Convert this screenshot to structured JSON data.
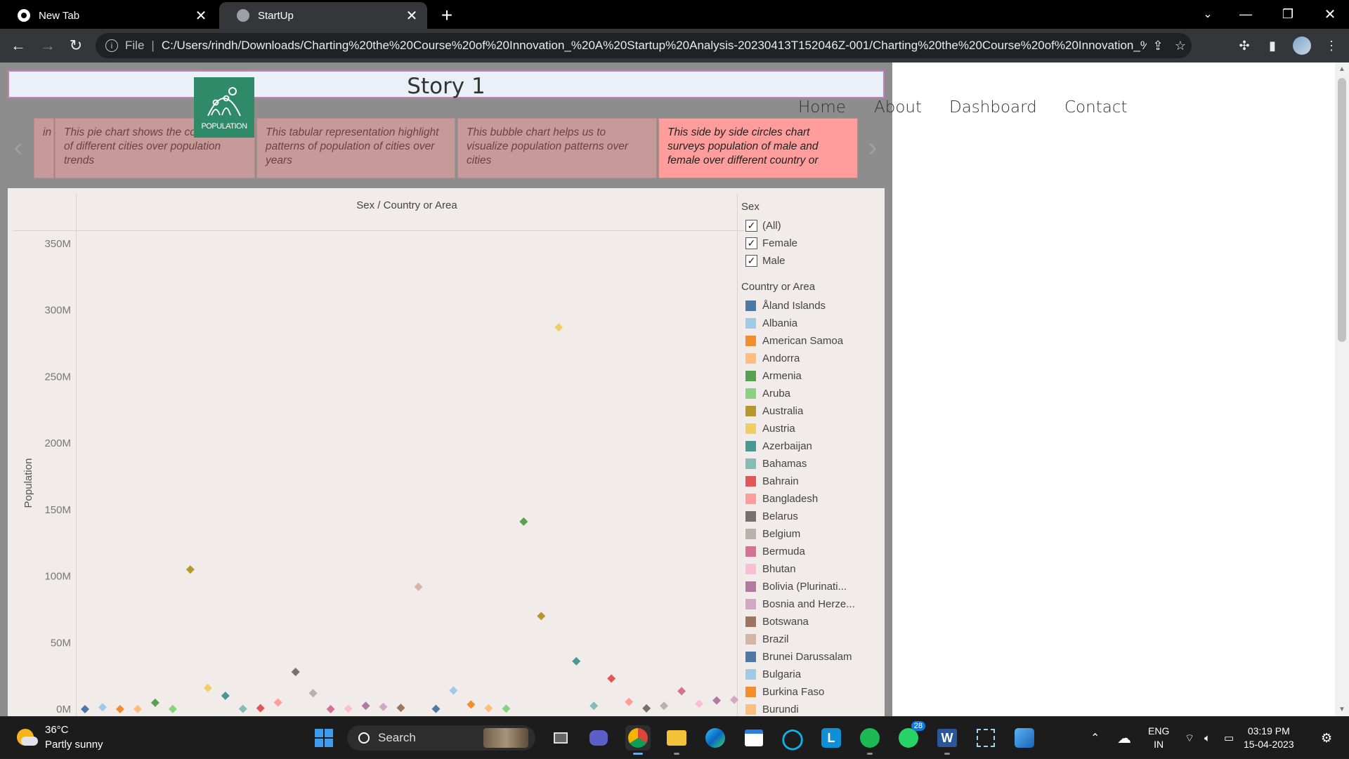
{
  "browser": {
    "tabs": [
      {
        "title": "New Tab",
        "active": false
      },
      {
        "title": "StartUp",
        "active": true
      }
    ],
    "scheme_label": "File",
    "url": "C:/Users/rindh/Downloads/Charting%20the%20Course%20of%20Innovation_%20A%20Startup%20Analysis-20230413T152046Z-001/Charting%20the%20Course%20of%20Innovation_%..."
  },
  "page": {
    "story_title": "Story 1",
    "logo_text": "POPULATION",
    "nav": [
      "Home",
      "About",
      "Dashboard",
      "Contact"
    ],
    "captions": [
      {
        "text": "in",
        "active": false
      },
      {
        "text": "This pie chart shows the contribution of different cities over population trends",
        "active": false
      },
      {
        "text": "This tabular representation highlight  patterns of population of cities over years",
        "active": false
      },
      {
        "text": "This bubble chart helps us to visualize population patterns over cities",
        "active": false
      },
      {
        "text": "This side by side circles chart surveys population of male and female over different country or",
        "active": true
      }
    ]
  },
  "chart_data": {
    "type": "scatter",
    "title": "Sex / Country or Area",
    "xlabel": "",
    "ylabel": "Population",
    "ylim": [
      0,
      360000000
    ],
    "yticks": [
      "0M",
      "50M",
      "100M",
      "150M",
      "200M",
      "250M",
      "300M",
      "350M"
    ],
    "ytick_values": [
      0,
      50000000,
      100000000,
      150000000,
      200000000,
      250000000,
      300000000,
      350000000
    ],
    "marker": "diamond",
    "gridlines": false,
    "legend_position": "right",
    "series": [
      {
        "name": "Åland Islands",
        "color": "#4e79a7",
        "values": [
          15000
        ]
      },
      {
        "name": "Albania",
        "color": "#a0cbe8",
        "values": [
          1400000
        ]
      },
      {
        "name": "American Samoa",
        "color": "#f28e2b",
        "values": [
          28000
        ]
      },
      {
        "name": "Andorra",
        "color": "#ffbe7d",
        "values": [
          38000
        ]
      },
      {
        "name": "Armenia",
        "color": "#59a14f",
        "values": [
          4800000
        ]
      },
      {
        "name": "Aruba",
        "color": "#8cd17d",
        "values": [
          52000
        ]
      },
      {
        "name": "Australia",
        "color": "#b6992d",
        "values": [
          105000000
        ]
      },
      {
        "name": "Austria",
        "color": "#f1ce63",
        "values": [
          16000000
        ]
      },
      {
        "name": "Azerbaijan",
        "color": "#499894",
        "values": [
          10000000
        ]
      },
      {
        "name": "Bahamas",
        "color": "#86bcb6",
        "values": [
          180000
        ]
      },
      {
        "name": "Bahrain",
        "color": "#e15759",
        "values": [
          700000
        ]
      },
      {
        "name": "Bangladesh",
        "color": "#ff9d9a",
        "values": [
          5000000
        ]
      },
      {
        "name": "Belarus",
        "color": "#79706e",
        "values": [
          28000000
        ]
      },
      {
        "name": "Belgium",
        "color": "#bab0ac",
        "values": [
          12000000
        ]
      },
      {
        "name": "Bermuda",
        "color": "#d37295",
        "values": [
          32000
        ]
      },
      {
        "name": "Bhutan",
        "color": "#fabfd2",
        "values": [
          350000
        ]
      },
      {
        "name": "Bolivia (Plurinati...",
        "color": "#b07aa1",
        "values": [
          2500000
        ]
      },
      {
        "name": "Bosnia and Herze...",
        "color": "#d4a6c8",
        "values": [
          1700000
        ]
      },
      {
        "name": "Botswana",
        "color": "#9d7660",
        "values": [
          1000000
        ]
      },
      {
        "name": "Brazil",
        "color": "#d7b5a6",
        "values": [
          92000000
        ]
      },
      {
        "name": "Brunei Darussalam",
        "color": "#4e79a7",
        "values": [
          200000
        ]
      },
      {
        "name": "Bulgaria",
        "color": "#a0cbe8",
        "values": [
          14000000
        ]
      },
      {
        "name": "Burkina Faso",
        "color": "#f28e2b",
        "values": [
          3500000
        ]
      },
      {
        "name": "Burundi",
        "color": "#ffbe7d",
        "values": [
          700000
        ]
      },
      {
        "name": "",
        "color": "#8cd17d",
        "values": [
          400000
        ]
      },
      {
        "name": "",
        "color": "#59a14f",
        "values": [
          141000000
        ]
      },
      {
        "name": "",
        "color": "#b6992d",
        "values": [
          70000000
        ]
      },
      {
        "name": "",
        "color": "#f1ce63",
        "values": [
          287000000
        ]
      },
      {
        "name": "",
        "color": "#499894",
        "values": [
          36000000
        ]
      },
      {
        "name": "",
        "color": "#86bcb6",
        "values": [
          2500000
        ]
      },
      {
        "name": "",
        "color": "#e15759",
        "values": [
          23000000
        ]
      },
      {
        "name": "",
        "color": "#ff9d9a",
        "values": [
          5500000
        ]
      },
      {
        "name": "",
        "color": "#79706e",
        "values": [
          600000
        ]
      },
      {
        "name": "",
        "color": "#bab0ac",
        "values": [
          2500000
        ]
      },
      {
        "name": "",
        "color": "#d37295",
        "values": [
          13500000
        ]
      },
      {
        "name": "",
        "color": "#fabfd2",
        "values": [
          4000000
        ]
      },
      {
        "name": "",
        "color": "#b07aa1",
        "values": [
          6500000
        ]
      },
      {
        "name": "",
        "color": "#d4a6c8",
        "values": [
          7000000
        ]
      }
    ]
  },
  "filters": {
    "sex_title": "Sex",
    "sex_options": [
      "(All)",
      "Female",
      "Male"
    ],
    "country_title": "Country or Area"
  },
  "taskbar": {
    "temp": "36°C",
    "weather": "Partly sunny",
    "search_label": "Search",
    "whatsapp_badge": "28",
    "lang_top": "ENG",
    "lang_bottom": "IN",
    "time": "03:19 PM",
    "date": "15-04-2023"
  }
}
